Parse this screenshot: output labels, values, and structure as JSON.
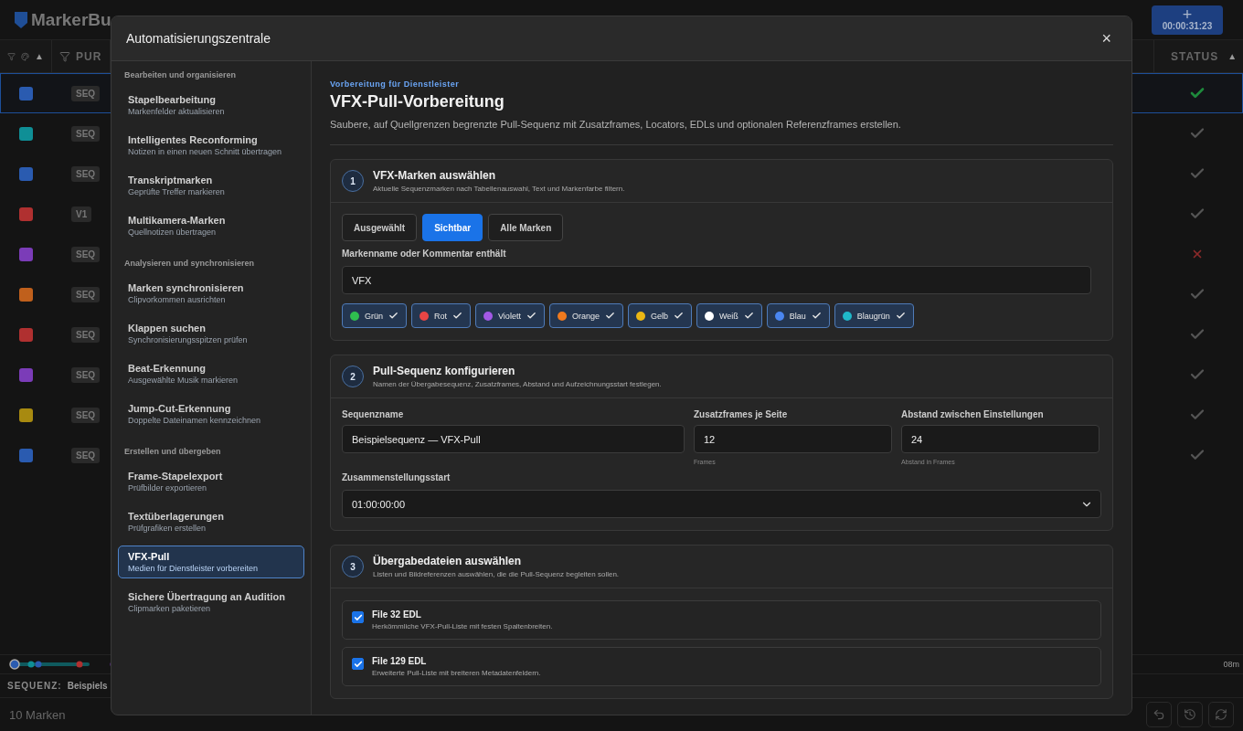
{
  "app": {
    "logo": "MarkerBu",
    "add_button": {
      "symbol": "+",
      "time": "00:00:31:23"
    }
  },
  "table": {
    "color_column": {
      "sort_mark": "▲"
    },
    "track_column": {
      "label": "PUR"
    },
    "status_column": {
      "label": "STATUS",
      "sort_mark": "▲"
    },
    "rows": [
      {
        "color": "#2a5bb0",
        "track": "SEQ",
        "kind": "check",
        "verified": true,
        "selected": true
      },
      {
        "color": "#0f8f96",
        "track": "SEQ",
        "kind": "check",
        "verified": false,
        "selected": false
      },
      {
        "color": "#2a5bb0",
        "track": "SEQ",
        "kind": "check",
        "verified": false,
        "selected": false
      },
      {
        "color": "#b03030",
        "track": "V1",
        "kind": "check",
        "verified": false,
        "selected": false
      },
      {
        "color": "#7b3cb8",
        "track": "SEQ",
        "kind": "cross",
        "verified": false,
        "selected": false
      },
      {
        "color": "#c0601c",
        "track": "SEQ",
        "kind": "check",
        "verified": false,
        "selected": false
      },
      {
        "color": "#b03030",
        "track": "SEQ",
        "kind": "check",
        "verified": false,
        "selected": false
      },
      {
        "color": "#7b3cb8",
        "track": "SEQ",
        "kind": "check",
        "verified": false,
        "selected": false
      },
      {
        "color": "#a88a10",
        "track": "SEQ",
        "kind": "check",
        "verified": false,
        "selected": false
      },
      {
        "color": "#2a5bb0",
        "track": "SEQ",
        "kind": "check",
        "verified": false,
        "selected": false
      }
    ]
  },
  "timeline": {
    "end_label": "08m"
  },
  "sequence_bar": {
    "label": "SEQUENZ:",
    "name": "Beispiels"
  },
  "footer": {
    "marker_count": "10 Marken"
  },
  "modal": {
    "title": "Automatisierungszentrale",
    "close": "×",
    "sidebar": [
      {
        "heading": "Bearbeiten und organisieren",
        "items": [
          {
            "title": "Stapelbearbeitung",
            "subtitle": "Markenfelder aktualisieren",
            "selected": false
          },
          {
            "title": "Intelligentes Reconforming",
            "subtitle": "Notizen in einen neuen Schnitt übertragen",
            "selected": false
          },
          {
            "title": "Transkriptmarken",
            "subtitle": "Geprüfte Treffer markieren",
            "selected": false
          },
          {
            "title": "Multikamera-Marken",
            "subtitle": "Quellnotizen übertragen",
            "selected": false
          }
        ]
      },
      {
        "heading": "Analysieren und synchronisieren",
        "items": [
          {
            "title": "Marken synchronisieren",
            "subtitle": "Clipvorkommen ausrichten",
            "selected": false
          },
          {
            "title": "Klappen suchen",
            "subtitle": "Synchronisierungsspitzen prüfen",
            "selected": false
          },
          {
            "title": "Beat-Erkennung",
            "subtitle": "Ausgewählte Musik markieren",
            "selected": false
          },
          {
            "title": "Jump-Cut-Erkennung",
            "subtitle": "Doppelte Dateinamen kennzeichnen",
            "selected": false
          }
        ]
      },
      {
        "heading": "Erstellen und übergeben",
        "items": [
          {
            "title": "Frame-Stapelexport",
            "subtitle": "Prüfbilder exportieren",
            "selected": false
          },
          {
            "title": "Textüberlagerungen",
            "subtitle": "Prüfgrafiken erstellen",
            "selected": false
          },
          {
            "title": "VFX-Pull",
            "subtitle": "Medien für Dienstleister vorbereiten",
            "selected": true
          },
          {
            "title": "Sichere Übertragung an Audition",
            "subtitle": "Clipmarken paketieren",
            "selected": false
          }
        ]
      }
    ],
    "content": {
      "eyebrow": "Vorbereitung für Dienstleister",
      "title": "VFX-Pull-Vorbereitung",
      "description": "Saubere, auf Quellgrenzen begrenzte Pull-Sequenz mit Zusatzframes, Locators, EDLs und optionalen Referenzframes erstellen.",
      "step1": {
        "number": "1",
        "title": "VFX-Marken auswählen",
        "subtitle": "Aktuelle Sequenzmarken nach Tabellenauswahl, Text und Markenfarbe filtern.",
        "scopes": [
          {
            "label": "Ausgewählt",
            "selected": false
          },
          {
            "label": "Sichtbar",
            "selected": true
          },
          {
            "label": "Alle Marken",
            "selected": false
          }
        ],
        "filter_label": "Markenname oder Kommentar enthält",
        "filter_value": "VFX",
        "colors": [
          {
            "label": "Grün",
            "color": "#2fbf4f",
            "checked": true
          },
          {
            "label": "Rot",
            "color": "#e84545",
            "checked": true
          },
          {
            "label": "Violett",
            "color": "#a259e6",
            "checked": true
          },
          {
            "label": "Orange",
            "color": "#f07a1e",
            "checked": true
          },
          {
            "label": "Gelb",
            "color": "#eab614",
            "checked": true
          },
          {
            "label": "Weiß",
            "color": "#ffffff",
            "checked": true
          },
          {
            "label": "Blau",
            "color": "#4a86f0",
            "checked": true
          },
          {
            "label": "Blaugrün",
            "color": "#1fb8c9",
            "checked": true
          }
        ]
      },
      "step2": {
        "number": "2",
        "title": "Pull-Sequenz konfigurieren",
        "subtitle": "Namen der Übergabesequenz, Zusatzframes, Abstand und Aufzeichnungsstart festlegen.",
        "fields": [
          {
            "label": "Sequenzname",
            "value": "Beispielsequenz — VFX-Pull"
          },
          {
            "label": "Zusatzframes je Seite",
            "value": "12",
            "hint": "Frames"
          },
          {
            "label": "Abstand zwischen Einstellungen",
            "value": "24",
            "hint": "Abstand in Frames"
          }
        ],
        "start_label": "Zusammenstellungsstart",
        "start_value": "01:00:00:00"
      },
      "step3": {
        "number": "3",
        "title": "Übergabedateien auswählen",
        "subtitle": "Listen und Bildreferenzen auswählen, die die Pull-Sequenz begleiten sollen.",
        "files": [
          {
            "title": "File 32 EDL",
            "subtitle": "Herkömmliche VFX-Pull-Liste mit festen Spaltenbreiten.",
            "checked": true
          },
          {
            "title": "File 129 EDL",
            "subtitle": "Erweiterte Pull-Liste mit breiteren Metadatenfeldern.",
            "checked": true
          }
        ]
      }
    }
  }
}
